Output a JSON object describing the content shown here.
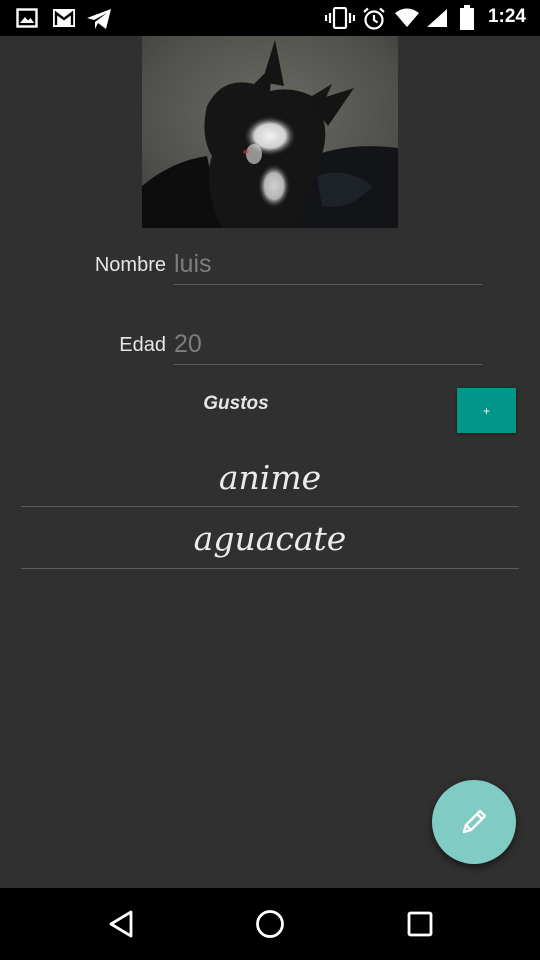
{
  "status_bar": {
    "time": "1:24",
    "icons": [
      "image-icon",
      "gmail-icon",
      "telegram-icon",
      "vibrate-icon",
      "alarm-icon",
      "wifi-icon",
      "signal-icon",
      "battery-icon"
    ]
  },
  "profile": {
    "photo_desc": "cat-photo",
    "name": {
      "label": "Nombre",
      "value": "luis"
    },
    "age": {
      "label": "Edad",
      "value": "20"
    }
  },
  "likes": {
    "title": "Gustos",
    "add_label": "+",
    "items": [
      "anime",
      "aguacate"
    ]
  },
  "fab": {
    "icon": "pencil-icon",
    "color": "#80cbc4"
  },
  "colors": {
    "background": "#303030",
    "accent": "#009688",
    "fab": "#80cbc4"
  },
  "nav_bar": {
    "icons": [
      "back-icon",
      "home-icon",
      "recents-icon"
    ]
  }
}
